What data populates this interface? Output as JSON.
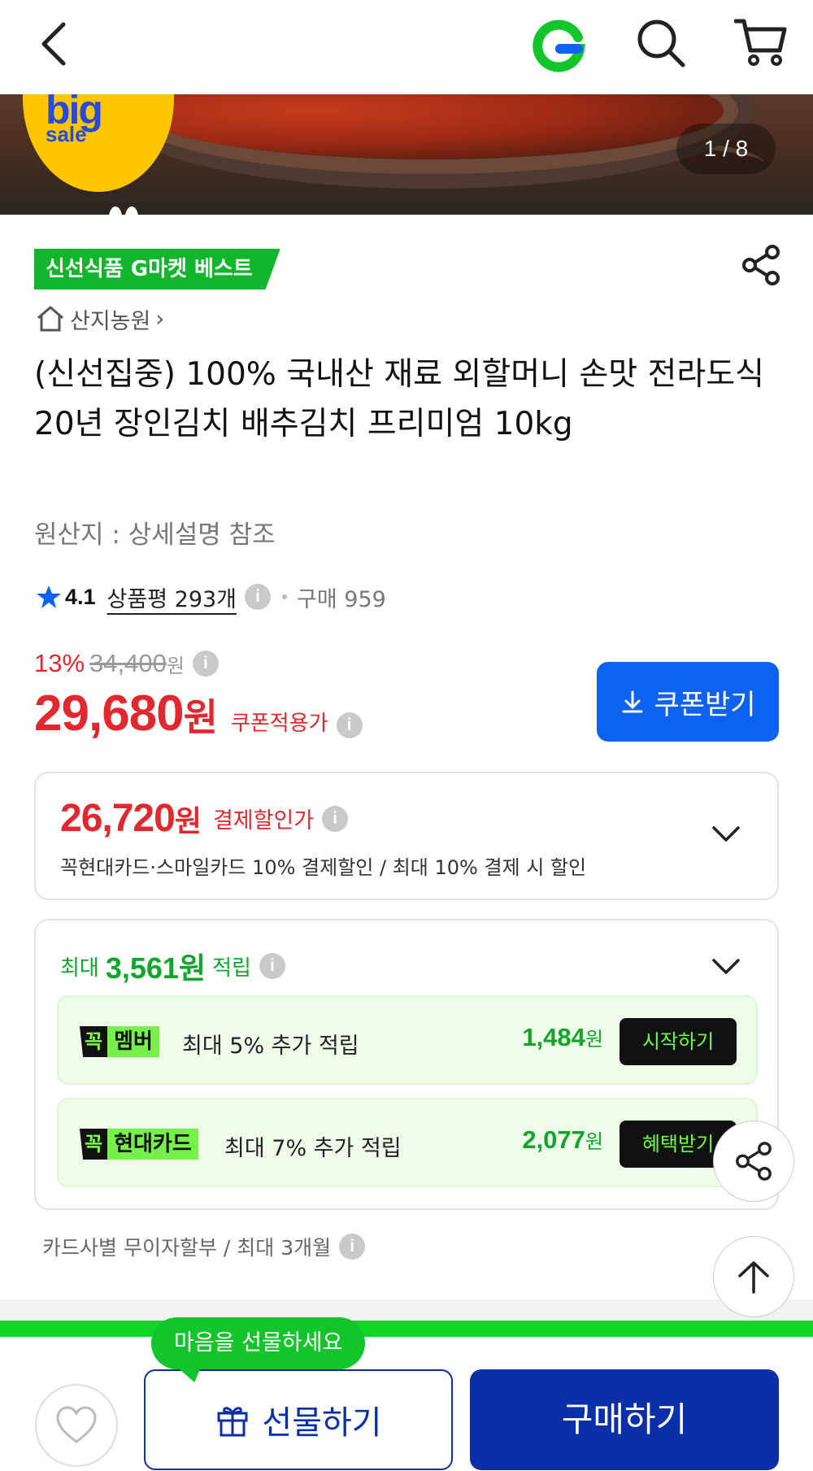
{
  "header": {
    "back_icon": "chevron-left-icon",
    "logo_icon": "gmarket-g-logo",
    "search_icon": "search-icon",
    "cart_icon": "cart-icon",
    "brand_color": "#12b52c"
  },
  "hero": {
    "badge_big": "big",
    "badge_sale": "sale",
    "counter": "1 / 8"
  },
  "product": {
    "best_tag": "신선식품 G마켓 베스트",
    "store_name": "산지농원",
    "store_chevron": "›",
    "title": "(신선집중) 100% 국내산 재료 외할머니 손맛 전라도식 20년 장인김치 배추김치 프리미엄 10kg",
    "origin": "원산지 : 상세설명 참조",
    "rating": "4.1",
    "review_link": "상품평 293개",
    "purchases": "구매 959",
    "info_glyph": "i"
  },
  "price": {
    "discount_pct": "13%",
    "original_price": "34,400",
    "original_unit": "원",
    "final_price": "29,680",
    "final_unit": "원",
    "final_label": "쿠폰적용가",
    "coupon_button": "쿠폰받기",
    "accent_red": "#e0282e",
    "accent_blue": "#0d63ef"
  },
  "card_payment": {
    "amount": "26,720",
    "unit": "원",
    "label": "결제할인가",
    "description": "꼭현대카드·스마일카드 10% 결제할인 / 최대 10% 결제 시 할인"
  },
  "rewards": {
    "prefix": "최대",
    "amount": "3,561원",
    "suffix": "적립",
    "rows": [
      {
        "tag_k": "꼭",
        "tag_name": "멤버",
        "text": "최대 5% 추가 적립",
        "points": "1,484",
        "unit": "원",
        "button": "시작하기"
      },
      {
        "tag_k": "꼭",
        "tag_name": "현대카드",
        "text": "최대 7% 추가 적립",
        "points": "2,077",
        "unit": "원",
        "button": "혜택받기"
      }
    ]
  },
  "installment": "카드사별 무이자할부 / 최대 3개월",
  "bottom_bar": {
    "gift_bubble": "마음을 선물하세요",
    "gift_button": "선물하기",
    "buy_button": "구매하기",
    "navy": "#0a2fa8"
  }
}
